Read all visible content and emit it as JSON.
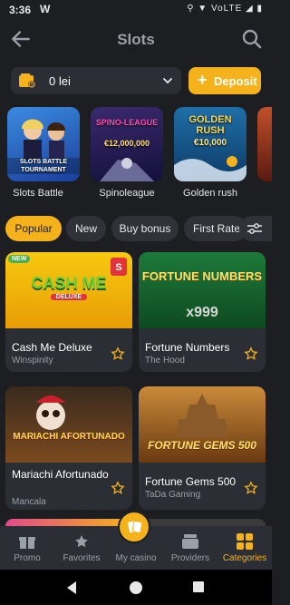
{
  "status": {
    "time": "3:36",
    "w": "W",
    "icons": "⚲ ▼ VoLTE ◢ ▮"
  },
  "header": {
    "title": "Slots"
  },
  "wallet": {
    "amount": "0 lei",
    "deposit_label": "Deposit"
  },
  "promos": [
    {
      "label": "Slots Battle",
      "text": "SLOTS BATTLE TOURNAMENT"
    },
    {
      "label": "Spinoleague",
      "text_top": "SPINO-LEAGUE",
      "text_bottom": "€12,000,000"
    },
    {
      "label": "Golden rush",
      "text_top": "GOLDEN RUSH",
      "text_bottom": "€10,000"
    }
  ],
  "filters": [
    "Popular",
    "New",
    "Buy bonus",
    "First Rate"
  ],
  "games": [
    {
      "name": "Cash Me Deluxe",
      "provider": "Winspinity",
      "thumb_title": "CASH ME",
      "thumb_sub": "DELUXE",
      "badge": "NEW"
    },
    {
      "name": "Fortune Numbers",
      "provider": "The Hood",
      "thumb_title": "FORTUNE NUMBERS",
      "thumb_sub": "x999"
    },
    {
      "name": "Mariachi Afortunado",
      "provider": "Mancala",
      "thumb_title": "MARIACHI AFORTUNADO"
    },
    {
      "name": "Fortune Gems 500",
      "provider": "TaDa Gaming",
      "thumb_title": "FORTUNE GEMS 500"
    }
  ],
  "nav": {
    "promo": "Promo",
    "favorites": "Favorites",
    "mycasino": "My casino",
    "providers": "Providers",
    "categories": "Categories"
  },
  "colors": {
    "accent": "#f5b21b",
    "bg": "#1c1e22",
    "card": "#2b2e34"
  }
}
